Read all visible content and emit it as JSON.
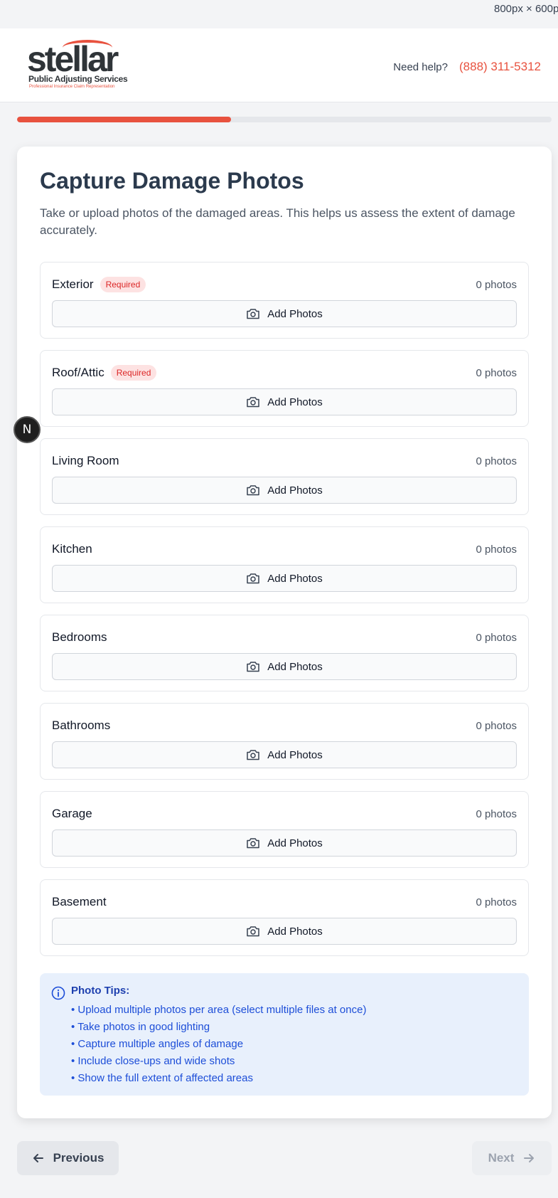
{
  "viewport_label": "800px × 600p",
  "brand": {
    "logo_word": "stellar",
    "logo_line1": "Public Adjusting Services",
    "logo_line2": "Professional Insurance Claim Representation",
    "accent_color": "#e8523f"
  },
  "header": {
    "help_label": "Need help?",
    "phone": "(888) 311-5312"
  },
  "progress": {
    "fraction": 0.4
  },
  "main": {
    "title": "Capture Damage Photos",
    "description": "Take or upload photos of the damaged areas. This helps us assess the extent of damage accurately.",
    "add_button_label": "Add Photos",
    "required_label": "Required",
    "areas": [
      {
        "name": "Exterior",
        "required": true,
        "count": "0 photos"
      },
      {
        "name": "Roof/Attic",
        "required": true,
        "count": "0 photos"
      },
      {
        "name": "Living Room",
        "required": false,
        "count": "0 photos"
      },
      {
        "name": "Kitchen",
        "required": false,
        "count": "0 photos"
      },
      {
        "name": "Bedrooms",
        "required": false,
        "count": "0 photos"
      },
      {
        "name": "Bathrooms",
        "required": false,
        "count": "0 photos"
      },
      {
        "name": "Garage",
        "required": false,
        "count": "0 photos"
      },
      {
        "name": "Basement",
        "required": false,
        "count": "0 photos"
      }
    ],
    "tips": {
      "title": "Photo Tips:",
      "items": [
        "• Upload multiple photos per area (select multiple files at once)",
        "• Take photos in good lighting",
        "• Capture multiple angles of damage",
        "• Include close-ups and wide shots",
        "• Show the full extent of affected areas"
      ]
    }
  },
  "footer": {
    "previous_label": "Previous",
    "next_label": "Next"
  },
  "dev_badge": "N"
}
